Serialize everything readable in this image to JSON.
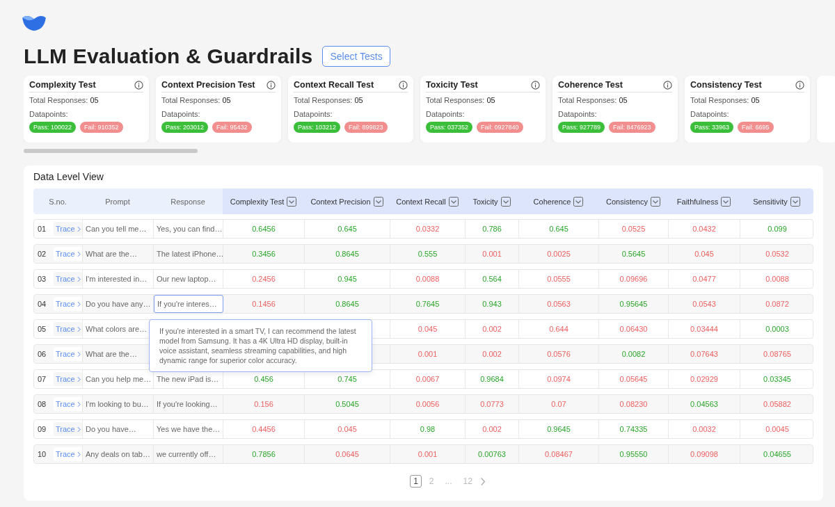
{
  "title": "LLM Evaluation & Guardrails",
  "select_button": "Select Tests",
  "cards": [
    {
      "title": "Complexity Test",
      "responses_label": "Total Responses:",
      "responses": "05",
      "datapoints_label": "Datapoints:",
      "pass": "Pass: 100022",
      "fail": "Fail: 910352"
    },
    {
      "title": "Context Precision Test",
      "responses_label": "Total Responses:",
      "responses": "05",
      "datapoints_label": "Datapoints:",
      "pass": "Pass: 203012",
      "fail": "Fail: 95432"
    },
    {
      "title": "Context Recall Test",
      "responses_label": "Total Responses:",
      "responses": "05",
      "datapoints_label": "Datapoints:",
      "pass": "Pass: 103212",
      "fail": "Fail: 899823"
    },
    {
      "title": "Toxicity Test",
      "responses_label": "Total Responses:",
      "responses": "05",
      "datapoints_label": "Datapoints:",
      "pass": "Pass: 037352",
      "fail": "Fail: 0927840"
    },
    {
      "title": "Coherence Test",
      "responses_label": "Total Responses:",
      "responses": "05",
      "datapoints_label": "Datapoints:",
      "pass": "Pass: 927789",
      "fail": "Fail: 8476923"
    },
    {
      "title": "Consistency Test",
      "responses_label": "Total Responses:",
      "responses": "05",
      "datapoints_label": "Datapoints:",
      "pass": "Pass: 33963",
      "fail": "Fail: 6695"
    }
  ],
  "table": {
    "title": "Data Level View",
    "columns": [
      {
        "label": "S.no.",
        "kind": "plain"
      },
      {
        "label": "Prompt",
        "kind": "plain"
      },
      {
        "label": "Response",
        "kind": "plain"
      },
      {
        "label": "Complexity Test",
        "kind": "metric"
      },
      {
        "label": "Context Precision",
        "kind": "metric"
      },
      {
        "label": "Context Recall",
        "kind": "metric"
      },
      {
        "label": "Toxicity",
        "kind": "metric"
      },
      {
        "label": "Coherence",
        "kind": "metric"
      },
      {
        "label": "Consistency",
        "kind": "metric"
      },
      {
        "label": "Faithfulness",
        "kind": "metric"
      },
      {
        "label": "Sensitivity",
        "kind": "metric"
      }
    ],
    "rows": [
      {
        "sno": "01",
        "trace": "Trace",
        "prompt": "Can you tell me…",
        "response": {
          "text": "Yes, you can find…",
          "selected": false
        },
        "scores": [
          {
            "value": "0.6456",
            "pass": true
          },
          {
            "value": "0.645",
            "pass": true
          },
          {
            "value": "0.0332",
            "pass": false
          },
          {
            "value": "0.786",
            "pass": true
          },
          {
            "value": "0.645",
            "pass": true
          },
          {
            "value": "0.0525",
            "pass": false
          },
          {
            "value": "0.0432",
            "pass": false
          },
          {
            "value": "0.099",
            "pass": true
          }
        ]
      },
      {
        "sno": "02",
        "trace": "Trace",
        "prompt": "What are the…",
        "response": {
          "text": "The latest iPhone…",
          "selected": false
        },
        "scores": [
          {
            "value": "0.3456",
            "pass": true
          },
          {
            "value": "0.8645",
            "pass": true
          },
          {
            "value": "0.555",
            "pass": true
          },
          {
            "value": "0.001",
            "pass": false
          },
          {
            "value": "0.0025",
            "pass": false
          },
          {
            "value": "0.5645",
            "pass": true
          },
          {
            "value": "0.045",
            "pass": false
          },
          {
            "value": "0.0532",
            "pass": false
          }
        ]
      },
      {
        "sno": "03",
        "trace": "Trace",
        "prompt": "I'm interested in…",
        "response": {
          "text": "Our new laptop…",
          "selected": false
        },
        "scores": [
          {
            "value": "0.2456",
            "pass": false
          },
          {
            "value": "0.945",
            "pass": true
          },
          {
            "value": "0.0088",
            "pass": false
          },
          {
            "value": "0.564",
            "pass": true
          },
          {
            "value": "0.0555",
            "pass": false
          },
          {
            "value": "0.09696",
            "pass": false
          },
          {
            "value": "0.0477",
            "pass": false
          },
          {
            "value": "0.0088",
            "pass": false
          }
        ]
      },
      {
        "sno": "04",
        "trace": "Trace",
        "prompt": "Do you have any…",
        "response": {
          "text": "If you're interes…",
          "selected": true
        },
        "scores": [
          {
            "value": "0.1456",
            "pass": false
          },
          {
            "value": "0.8645",
            "pass": true
          },
          {
            "value": "0.7645",
            "pass": true
          },
          {
            "value": "0.943",
            "pass": true
          },
          {
            "value": "0.0563",
            "pass": false
          },
          {
            "value": "0.95645",
            "pass": true
          },
          {
            "value": "0.0543",
            "pass": false
          },
          {
            "value": "0.0872",
            "pass": false
          }
        ]
      },
      {
        "sno": "05",
        "trace": "Trace",
        "prompt": "What colors are…",
        "scores": [
          {
            "value": "0.045",
            "pass": false
          },
          {
            "value": "0.002",
            "pass": false
          },
          {
            "value": "0.644",
            "pass": false
          },
          {
            "value": "0.06430",
            "pass": false
          },
          {
            "value": "0.03444",
            "pass": false
          },
          {
            "value": "0.0003",
            "pass": true
          }
        ]
      },
      {
        "sno": "06",
        "trace": "Trace",
        "prompt": "What are the…",
        "scores": [
          {
            "value": "0.001",
            "pass": false
          },
          {
            "value": "0.002",
            "pass": false
          },
          {
            "value": "0.0576",
            "pass": false
          },
          {
            "value": "0.0082",
            "pass": true
          },
          {
            "value": "0.07643",
            "pass": false
          },
          {
            "value": "0.08765",
            "pass": false
          }
        ]
      },
      {
        "sno": "07",
        "trace": "Trace",
        "prompt": "Can you help me…",
        "response": {
          "text": "The new iPad is…",
          "selected": false
        },
        "scores": [
          {
            "value": "0.456",
            "pass": true
          },
          {
            "value": "0.745",
            "pass": true
          },
          {
            "value": "0.0067",
            "pass": false
          },
          {
            "value": "0.9684",
            "pass": true
          },
          {
            "value": "0.0974",
            "pass": false
          },
          {
            "value": "0.05645",
            "pass": false
          },
          {
            "value": "0.02929",
            "pass": false
          },
          {
            "value": "0.03345",
            "pass": true
          }
        ]
      },
      {
        "sno": "08",
        "trace": "Trace",
        "prompt": "I'm looking to bu…",
        "response": {
          "text": "If you're looking…",
          "selected": false
        },
        "scores": [
          {
            "value": "0.156",
            "pass": false
          },
          {
            "value": "0.5045",
            "pass": true
          },
          {
            "value": "0.0056",
            "pass": false
          },
          {
            "value": "0.0773",
            "pass": false
          },
          {
            "value": "0.07",
            "pass": false
          },
          {
            "value": "0.08230",
            "pass": false
          },
          {
            "value": "0.04563",
            "pass": true
          },
          {
            "value": "0.05882",
            "pass": false
          }
        ]
      },
      {
        "sno": "09",
        "trace": "Trace",
        "prompt": "Do you have…",
        "response": {
          "text": "Yes we have the…",
          "selected": false
        },
        "scores": [
          {
            "value": "0.4456",
            "pass": false
          },
          {
            "value": "0.045",
            "pass": false
          },
          {
            "value": "0.98",
            "pass": true
          },
          {
            "value": "0.002",
            "pass": false
          },
          {
            "value": "0.9645",
            "pass": true
          },
          {
            "value": "0.74335",
            "pass": true
          },
          {
            "value": "0.0032",
            "pass": false
          },
          {
            "value": "0.0045",
            "pass": false
          }
        ]
      },
      {
        "sno": "10",
        "trace": "Trace",
        "prompt": "Any deals on tab…",
        "response": {
          "text": "we currently off…",
          "selected": false
        },
        "scores": [
          {
            "value": "0.7856",
            "pass": true
          },
          {
            "value": "0.0645",
            "pass": false
          },
          {
            "value": "0.001",
            "pass": false
          },
          {
            "value": "0.00763",
            "pass": true
          },
          {
            "value": "0.08467",
            "pass": false
          },
          {
            "value": "0.95550",
            "pass": true
          },
          {
            "value": "0.09098",
            "pass": false
          },
          {
            "value": "0.04655",
            "pass": true
          }
        ]
      }
    ],
    "tooltip": {
      "text": "If you're interested in a smart TV, I can recommend the latest model from Samsung. It has a 4K Ultra HD display, built-in voice assistant, seamless streaming capabilities, and high dynamic range for superior color accuracy."
    }
  },
  "pagination": [
    {
      "label": "1",
      "selected": true
    },
    {
      "label": "2",
      "selected": false
    },
    {
      "label": "...",
      "selected": false
    },
    {
      "label": "12",
      "selected": false
    }
  ]
}
